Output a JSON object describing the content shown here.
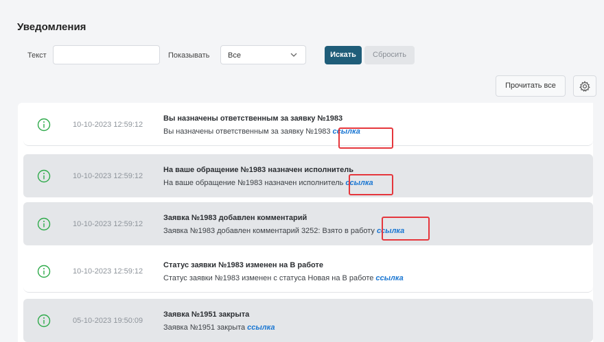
{
  "page": {
    "title": "Уведомления"
  },
  "filters": {
    "text_label": "Текст",
    "text_value": "",
    "text_placeholder": "",
    "show_label": "Показывать",
    "show_value": "Все",
    "search_button": "Искать",
    "reset_button": "Сбросить"
  },
  "actions": {
    "read_all_button": "Прочитать все",
    "settings_icon": "gear-icon"
  },
  "notifications": [
    {
      "icon": "info-circle-icon",
      "date": "10-10-2023 12:59:12",
      "title": "Вы назначены ответственным за заявку №1983",
      "text": "Вы назначены ответственным за заявку №1983",
      "link": "ссылка"
    },
    {
      "icon": "info-circle-icon",
      "date": "10-10-2023 12:59:12",
      "title": "На ваше обращение №1983 назначен исполнитель",
      "text": "На ваше обращение №1983 назначен исполнитель",
      "link": "ссылка"
    },
    {
      "icon": "info-circle-icon",
      "date": "10-10-2023 12:59:12",
      "title": "Заявка №1983 добавлен комментарий",
      "text": "Заявка №1983 добавлен комментарий 3252: Взято в работу",
      "link": "ссылка"
    },
    {
      "icon": "info-circle-icon",
      "date": "10-10-2023 12:59:12",
      "title": "Статус заявки №1983 изменен на В работе",
      "text": "Статус заявки №1983 изменен с статуса Новая на В работе",
      "link": "ссылка"
    },
    {
      "icon": "info-circle-icon",
      "date": "05-10-2023 19:50:09",
      "title": "Заявка №1951 закрыта",
      "text": "Заявка №1951 закрыта",
      "link": "ссылка"
    }
  ],
  "colors": {
    "primary_button": "#1f5d79",
    "info_icon": "#2eaa4a",
    "link": "#1976d2",
    "highlight_box": "#e5353b"
  }
}
